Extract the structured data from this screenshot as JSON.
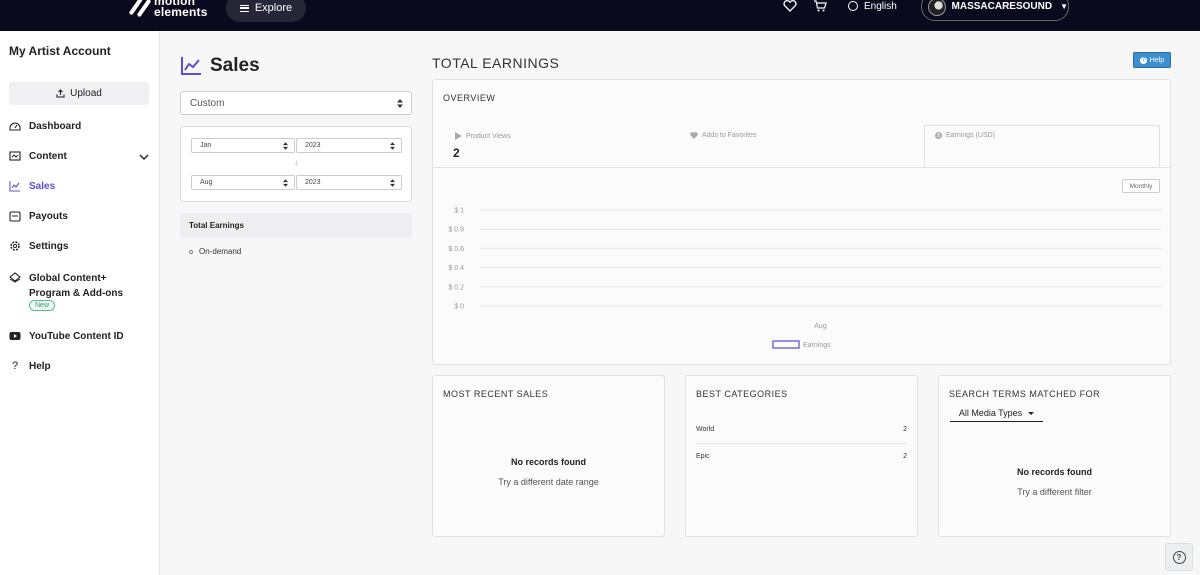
{
  "topnav": {
    "logo_line1": "motion",
    "logo_line2": "elements",
    "explore": "Explore",
    "language": "English",
    "username": "MASSACARESOUND"
  },
  "sidebar": {
    "title": "My Artist Account",
    "upload": "Upload",
    "items": [
      {
        "label": "Dashboard",
        "icon": "dashboard-icon"
      },
      {
        "label": "Content",
        "icon": "content-icon"
      },
      {
        "label": "Sales",
        "icon": "sales-chart-icon"
      },
      {
        "label": "Payouts",
        "icon": "payouts-icon"
      },
      {
        "label": "Settings",
        "icon": "gear-icon"
      }
    ],
    "global_line1": "Global Content+",
    "global_line2": "Program & Add-ons",
    "new_badge": "New",
    "youtube": "YouTube Content ID",
    "help": "Help"
  },
  "filters": {
    "heading": "Sales",
    "range": "Custom",
    "from_month": "Jan",
    "from_year": "2023",
    "to_month": "Aug",
    "to_year": "2023",
    "total_earnings": "Total Earnings",
    "on_demand": "On-demand"
  },
  "main": {
    "title": "TOTAL EARNINGS",
    "help": "Help",
    "overview": "OVERVIEW",
    "tabs": {
      "views": "Product Views",
      "favorites": "Adds to Favorites",
      "earnings": "Earnings (USD)"
    },
    "views_value": "2",
    "monthly": "Monthly"
  },
  "chart_data": {
    "type": "line",
    "categories": [
      "Aug"
    ],
    "series": [
      {
        "name": "Earnings",
        "values": [
          0
        ]
      }
    ],
    "y_ticks": [
      "$ 1",
      "$ 0.8",
      "$ 0.6",
      "$ 0.4",
      "$ 0.2",
      "$ 0"
    ],
    "ylim": [
      0,
      1
    ],
    "grid": true,
    "legend": "bottom",
    "color": "#7b6cd9"
  },
  "recent_sales": {
    "title": "MOST RECENT SALES",
    "empty": "No records found",
    "hint": "Try a different date range"
  },
  "best_categories": {
    "title": "BEST CATEGORIES",
    "rows": [
      {
        "name": "World",
        "count": "2"
      },
      {
        "name": "Epic",
        "count": "2"
      }
    ]
  },
  "search_terms": {
    "title": "SEARCH TERMS MATCHED FOR",
    "filter": "All Media Types",
    "empty": "No records found",
    "hint": "Try a different filter"
  }
}
